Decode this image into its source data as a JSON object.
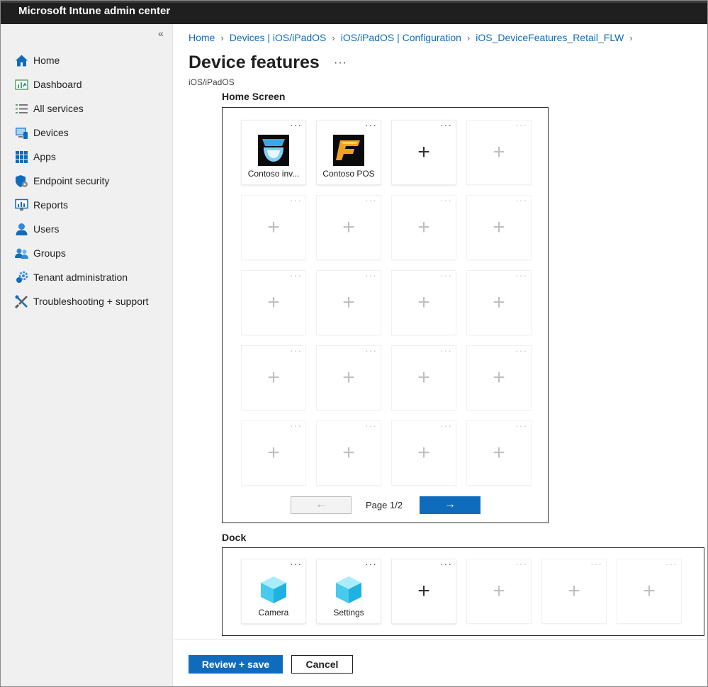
{
  "app": {
    "title": "Microsoft Intune admin center"
  },
  "sidebar": {
    "collapse_glyph": "«",
    "items": [
      {
        "label": "Home",
        "icon": "home-icon"
      },
      {
        "label": "Dashboard",
        "icon": "dashboard-icon"
      },
      {
        "label": "All services",
        "icon": "list-icon"
      },
      {
        "label": "Devices",
        "icon": "devices-icon"
      },
      {
        "label": "Apps",
        "icon": "apps-grid-icon"
      },
      {
        "label": "Endpoint security",
        "icon": "shield-icon"
      },
      {
        "label": "Reports",
        "icon": "reports-icon"
      },
      {
        "label": "Users",
        "icon": "user-icon"
      },
      {
        "label": "Groups",
        "icon": "groups-icon"
      },
      {
        "label": "Tenant administration",
        "icon": "gear-icon"
      },
      {
        "label": "Troubleshooting + support",
        "icon": "tools-icon"
      }
    ]
  },
  "breadcrumb": [
    "Home",
    "Devices | iOS/iPadOS",
    "iOS/iPadOS | Configuration",
    "iOS_DeviceFeatures_Retail_FLW"
  ],
  "page": {
    "title": "Device features",
    "more": "···",
    "subtitle": "iOS/iPadOS"
  },
  "home_screen": {
    "label": "Home Screen",
    "apps": [
      {
        "label": "Contoso inv...",
        "icon": "contoso-inventory-app-icon"
      },
      {
        "label": "Contoso POS",
        "icon": "contoso-pos-app-icon"
      }
    ],
    "pager": {
      "prev": "←",
      "indicator": "Page 1/2",
      "next": "→"
    }
  },
  "dock": {
    "label": "Dock",
    "apps": [
      {
        "label": "Camera",
        "icon": "cube-app-icon"
      },
      {
        "label": "Settings",
        "icon": "cube-app-icon"
      }
    ]
  },
  "tile": {
    "more": "···",
    "plus": "+"
  },
  "footer": {
    "save": "Review + save",
    "cancel": "Cancel"
  },
  "colors": {
    "accent": "#0f6cbd",
    "topbar": "#1f1f1f",
    "sidebar": "#f0f0f0"
  }
}
